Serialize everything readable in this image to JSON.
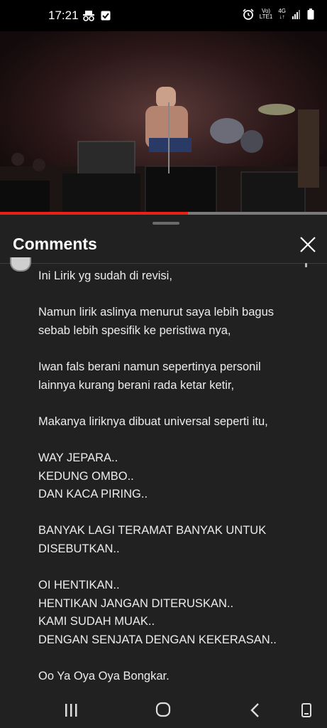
{
  "status_bar": {
    "time": "17:21",
    "network_top": "Vo)",
    "network_bottom": "LTE1",
    "generation": "4G",
    "icons": [
      "incognito-icon",
      "check-box-icon",
      "alarm-icon",
      "signal-icon",
      "battery-icon"
    ]
  },
  "video": {
    "progress": 0.575,
    "accent_color": "#e62117"
  },
  "comments_panel": {
    "title": "Comments",
    "comment": {
      "paragraphs": [
        [
          "Ini Lirik yg sudah di revisi,"
        ],
        [
          "Namun lirik aslinya menurut saya lebih bagus",
          "sebab lebih spesifik ke peristiwa nya,"
        ],
        [
          "Iwan fals berani namun sepertinya personil",
          "lainnya kurang berani rada ketar ketir,"
        ],
        [
          "Makanya liriknya dibuat universal seperti itu,"
        ],
        [
          "WAY JEPARA..",
          "KEDUNG OMBO..",
          "DAN KACA PIRING.."
        ],
        [
          "BANYAK LAGI TERAMAT BANYAK UNTUK",
          "DISEBUTKAN.."
        ],
        [
          "OI HENTIKAN..",
          "HENTIKAN JANGAN DITERUSKAN..",
          "KAMI SUDAH MUAK..",
          "DENGAN SENJATA DENGAN KEKERASAN.."
        ],
        [
          "Oo Ya Oya Oya Bongkar."
        ]
      ]
    }
  },
  "nav_bar": {
    "buttons": [
      "recent-apps-icon",
      "home-icon",
      "back-icon",
      "rotate-icon"
    ]
  }
}
